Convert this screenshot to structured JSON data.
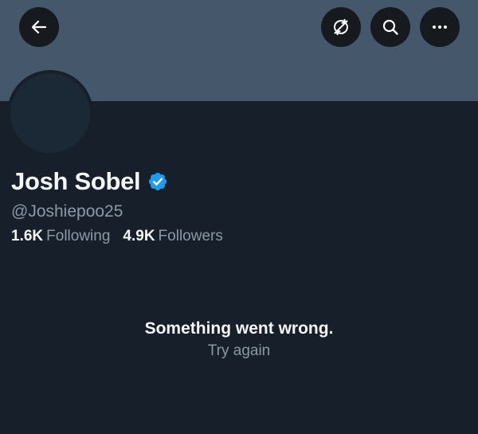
{
  "header": {
    "back_icon": "arrow-left-icon",
    "noretweet_icon": "retweet-off-icon",
    "search_icon": "search-icon",
    "more_icon": "more-horizontal-icon"
  },
  "profile": {
    "display_name": "Josh Sobel",
    "verified": true,
    "handle": "@Joshiepoo25",
    "following_count": "1.6K",
    "following_label": "Following",
    "followers_count": "4.9K",
    "followers_label": "Followers"
  },
  "error": {
    "message": "Something went wrong.",
    "retry_label": "Try again"
  },
  "colors": {
    "background": "#17202a",
    "banner": "#44576b",
    "primary_text": "#f4f6f8",
    "secondary_text": "#8b98a5",
    "verified_blue": "#1d9bf0"
  }
}
